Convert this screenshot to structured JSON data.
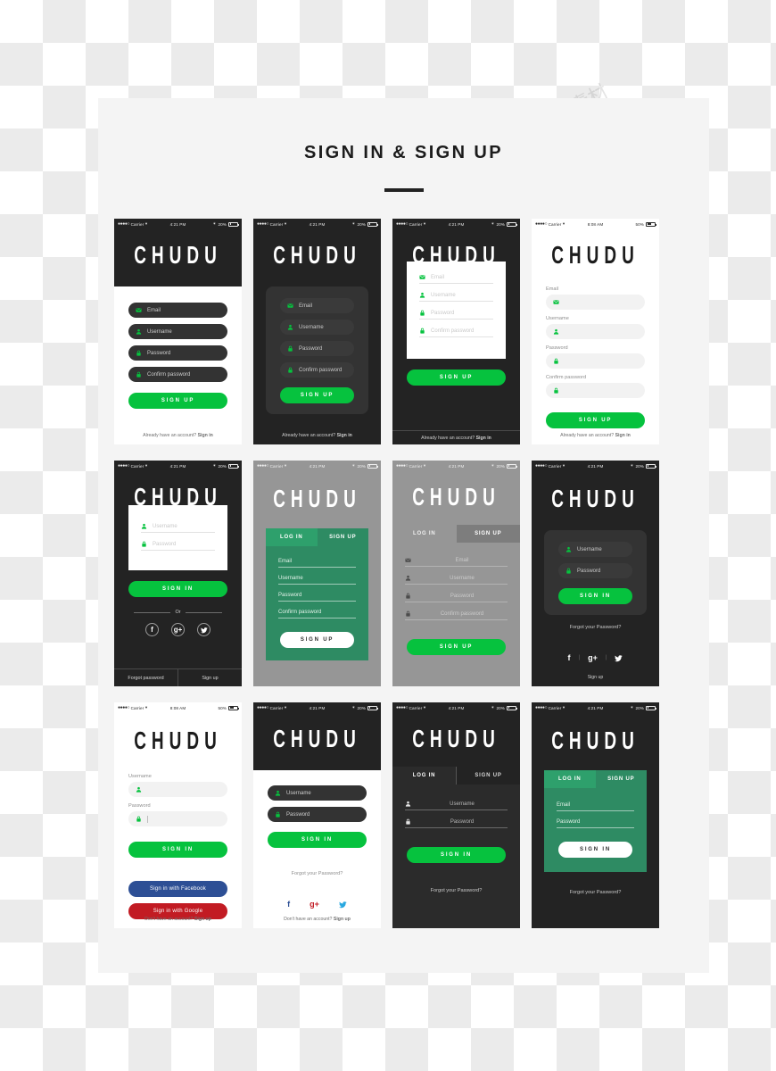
{
  "page": {
    "title": "SIGN IN & SIGN UP",
    "brand": "CHUDU",
    "accent_green": "#06c23e",
    "dark": "#232323",
    "gray": "#969696",
    "green_card": "#2e8b63",
    "facebook_blue": "#2d4f95",
    "google_red": "#c21b23",
    "watermark": "豆丁素材",
    "watermark_url": "v.docin.com"
  },
  "status_bar": {
    "dots": "●●●●○",
    "carrier": "Carrier",
    "wifi": "▾",
    "time_pm": "4:21 PM",
    "time_am": "8:08 AM",
    "battery_20": "20%",
    "battery_50": "50%",
    "bluetooth": "✶"
  },
  "labels": {
    "email": "Email",
    "username": "Username",
    "password": "Password",
    "confirm_password": "Confirm password",
    "sign_up": "SIGN UP",
    "sign_in": "SIGN IN",
    "log_in": "LOG IN",
    "tab_sign_up": "SIGN UP",
    "or": "Or",
    "forgot_password": "Forgot password",
    "forgot_your_password": "Forgot your Password?",
    "sign_up_plain": "Sign up",
    "already_prefix": "Already have an account? ",
    "already_link": "Sign in",
    "dont_prefix": "Don't have an account? ",
    "dont_link": "Sign up",
    "facebook_btn": "Sign in with Facebook",
    "google_btn": "Sign in with Google"
  },
  "icons": {
    "mail": "mail-icon",
    "user": "user-icon",
    "lock": "lock-icon",
    "facebook": "f",
    "google": "g+",
    "twitter": "🐦"
  },
  "screens": [
    {
      "id": 1,
      "name": "signup-dark-header-pills"
    },
    {
      "id": 2,
      "name": "signup-dark-card-pills"
    },
    {
      "id": 3,
      "name": "signup-white-card-underline"
    },
    {
      "id": 4,
      "name": "signup-white-labeled"
    },
    {
      "id": 5,
      "name": "signin-white-card-social"
    },
    {
      "id": 6,
      "name": "signup-green-card-tabs"
    },
    {
      "id": 7,
      "name": "signup-gray-tabs"
    },
    {
      "id": 8,
      "name": "signin-dark-card-social"
    },
    {
      "id": 9,
      "name": "signin-white-social-buttons"
    },
    {
      "id": 10,
      "name": "signin-dark-header-pills"
    },
    {
      "id": 11,
      "name": "signin-dark-tabs"
    },
    {
      "id": 12,
      "name": "signin-green-card-tabs"
    }
  ]
}
